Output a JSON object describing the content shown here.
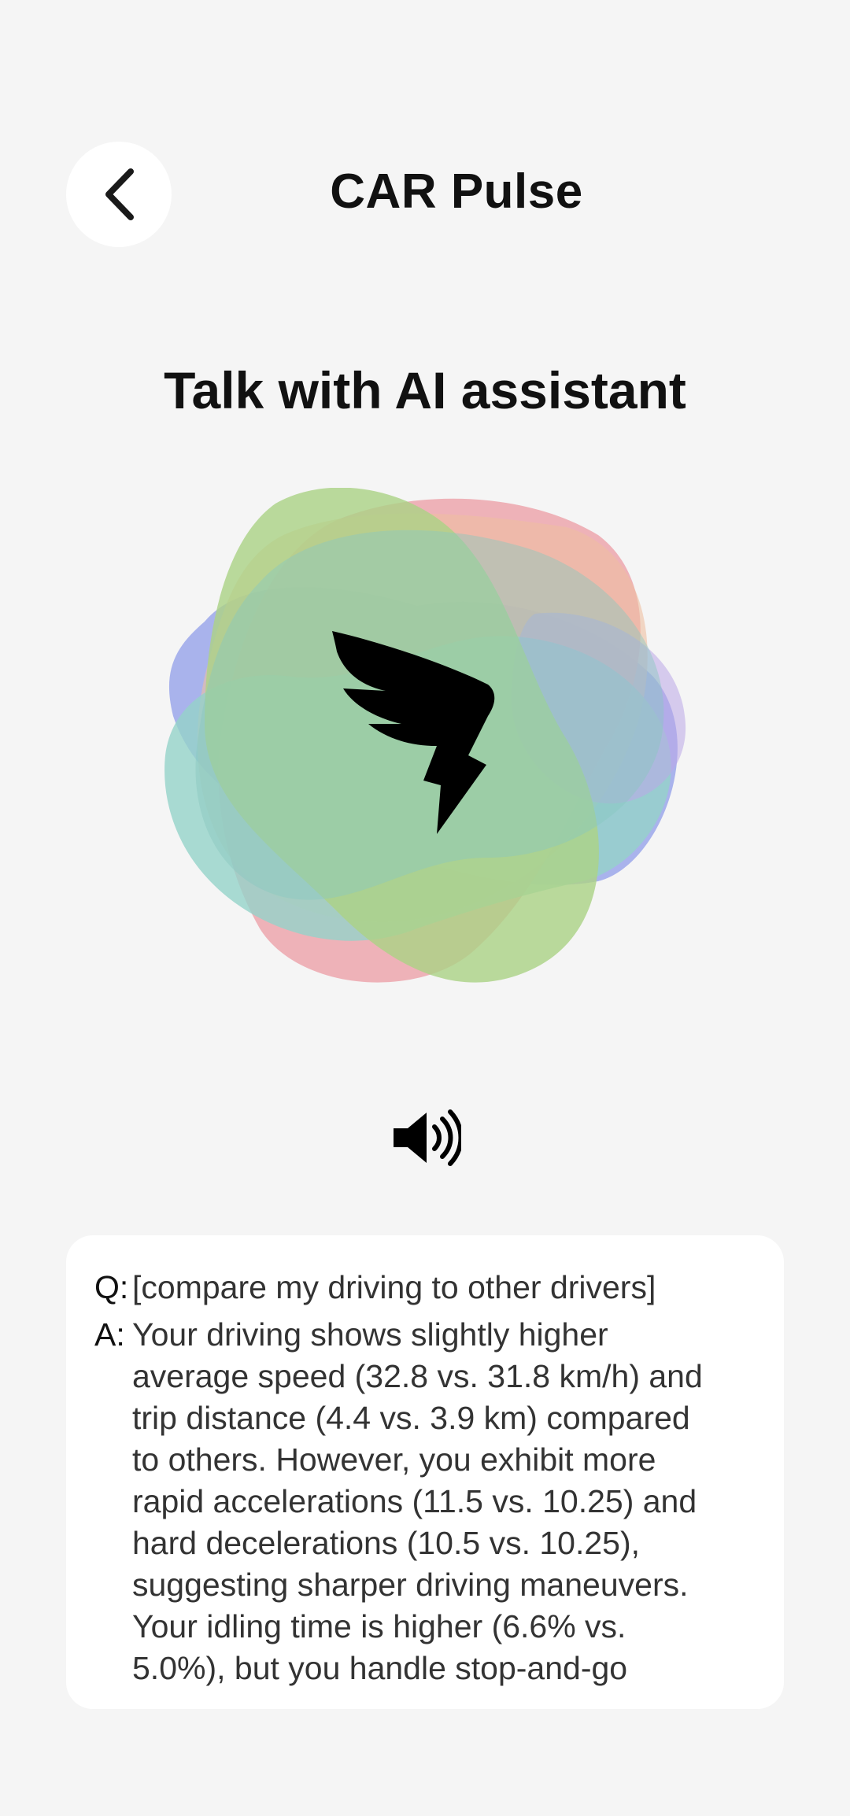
{
  "header": {
    "back_icon": "chevron-left-icon",
    "title": "CAR Pulse"
  },
  "main": {
    "heading": "Talk with AI assistant",
    "orb_icon": "winged-lightning-logo",
    "speaker_icon": "speaker-volume-icon"
  },
  "transcript": {
    "question_prefix": "Q:",
    "question": "[compare my driving to other drivers]",
    "answer_prefix": "A:",
    "answer": "Your driving shows slightly higher\naverage speed (32.8 vs. 31.8 km/h) and\ntrip distance (4.4 vs. 3.9 km) compared\nto others. However, you exhibit more\nrapid accelerations (11.5 vs. 10.25) and\nhard decelerations (10.5 vs. 10.25),\nsuggesting sharper driving maneuvers.\nYour idling time is higher (6.6% vs.\n5.0%), but you handle stop-and-go"
  },
  "colors": {
    "background": "#f5f5f5",
    "card": "#ffffff",
    "text": "#111111"
  }
}
